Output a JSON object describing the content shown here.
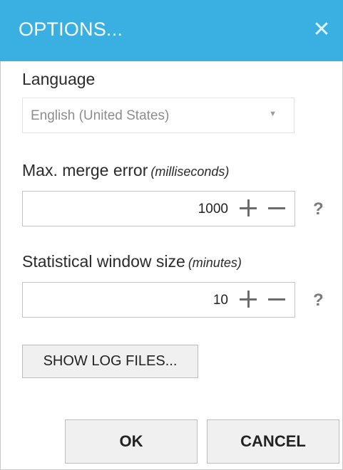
{
  "dialog": {
    "title": "OPTIONS...",
    "close_icon": "close-icon",
    "close_glyph": "✕"
  },
  "language": {
    "label": "Language",
    "value": "English (United States)",
    "arrow_glyph": "▼"
  },
  "merge_error": {
    "label": "Max. merge error",
    "hint": "(milliseconds)",
    "value": "1000",
    "help": "?"
  },
  "window_size": {
    "label": "Statistical window size",
    "hint": "(minutes)",
    "value": "10",
    "help": "?"
  },
  "buttons": {
    "show_logs": "SHOW LOG FILES...",
    "ok": "OK",
    "cancel": "CANCEL"
  },
  "colors": {
    "titlebar": "#3ab0e2",
    "button_bg": "#f0f0f0"
  }
}
